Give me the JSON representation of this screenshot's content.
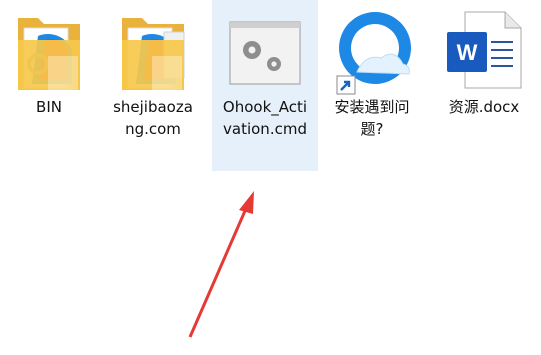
{
  "desktop": {
    "items": [
      {
        "name": "BIN",
        "icon": "folder-icon",
        "selected": false
      },
      {
        "name": "shejibaozang.com",
        "icon": "folder-icon",
        "selected": false
      },
      {
        "name": "Ohook_Activation.cmd",
        "icon": "cmd-script-icon",
        "selected": true
      },
      {
        "name": "安装遇到问题?",
        "icon": "qq-browser-shortcut-icon",
        "selected": false
      },
      {
        "name": "资源.docx",
        "icon": "word-document-icon",
        "selected": false
      }
    ]
  },
  "annotation": {
    "icon": "red-arrow",
    "color": "#e53935"
  },
  "colors": {
    "selection": "#e5f0fa",
    "folder": "#f6c84b",
    "word": "#185abd"
  }
}
